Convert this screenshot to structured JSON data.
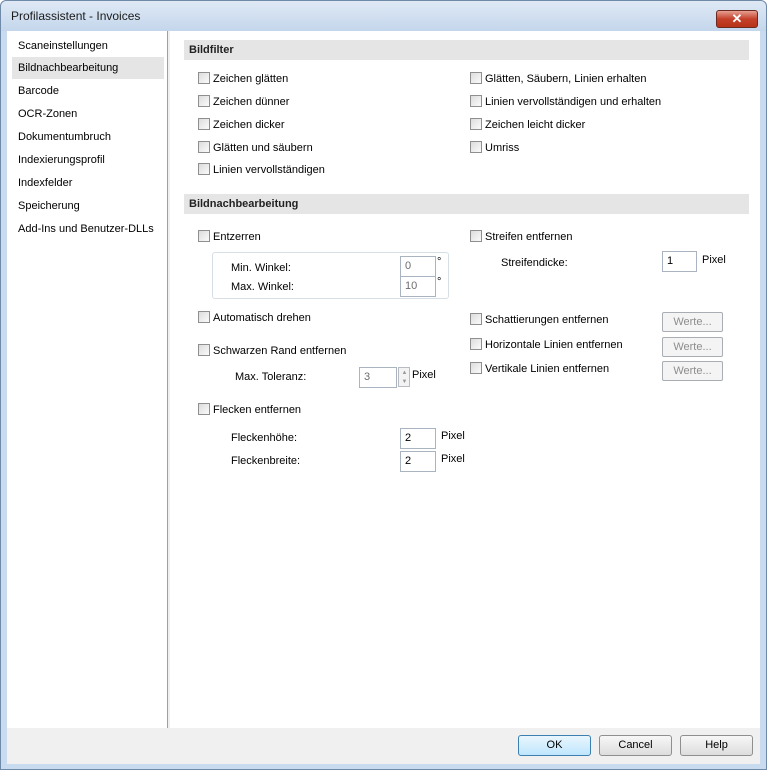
{
  "window": {
    "title": "Profilassistent - Invoices",
    "close": "✕"
  },
  "sidebar": {
    "items": [
      "Scaneinstellungen",
      "Bildnachbearbeitung",
      "Barcode",
      "OCR-Zonen",
      "Dokumentumbruch",
      "Indexierungsprofil",
      "Indexfelder",
      "Speicherung",
      "Add-Ins und Benutzer-DLLs"
    ],
    "active_index": 1
  },
  "bildfilter": {
    "header": "Bildfilter",
    "left": [
      "Zeichen glätten",
      "Zeichen dünner",
      "Zeichen dicker",
      "Glätten und säubern",
      "Linien vervollständigen"
    ],
    "right": [
      "Glätten, Säubern, Linien erhalten",
      "Linien vervollständigen und erhalten",
      "Zeichen leicht dicker",
      "Umriss"
    ]
  },
  "bildnach": {
    "header": "Bildnachbearbeitung",
    "entzerren": "Entzerren",
    "min_winkel_label": "Min. Winkel:",
    "min_winkel_value": "0",
    "max_winkel_label": "Max. Winkel:",
    "max_winkel_value": "10",
    "degree": "°",
    "auto_drehen": "Automatisch drehen",
    "schwarzen_rand": "Schwarzen Rand entfernen",
    "max_toleranz_label": "Max. Toleranz:",
    "max_toleranz_value": "3",
    "pixel": "Pixel",
    "flecken": "Flecken entfernen",
    "fleckenhoehe_label": "Fleckenhöhe:",
    "fleckenhoehe_value": "2",
    "fleckenbreite_label": "Fleckenbreite:",
    "fleckenbreite_value": "2",
    "streifen": "Streifen entfernen",
    "streifendicke_label": "Streifendicke:",
    "streifendicke_value": "1",
    "schattierungen": "Schattierungen entfernen",
    "horizontale": "Horizontale Linien entfernen",
    "vertikale": "Vertikale Linien entfernen",
    "werte": "Werte..."
  },
  "footer": {
    "ok": "OK",
    "cancel": "Cancel",
    "help": "Help"
  }
}
